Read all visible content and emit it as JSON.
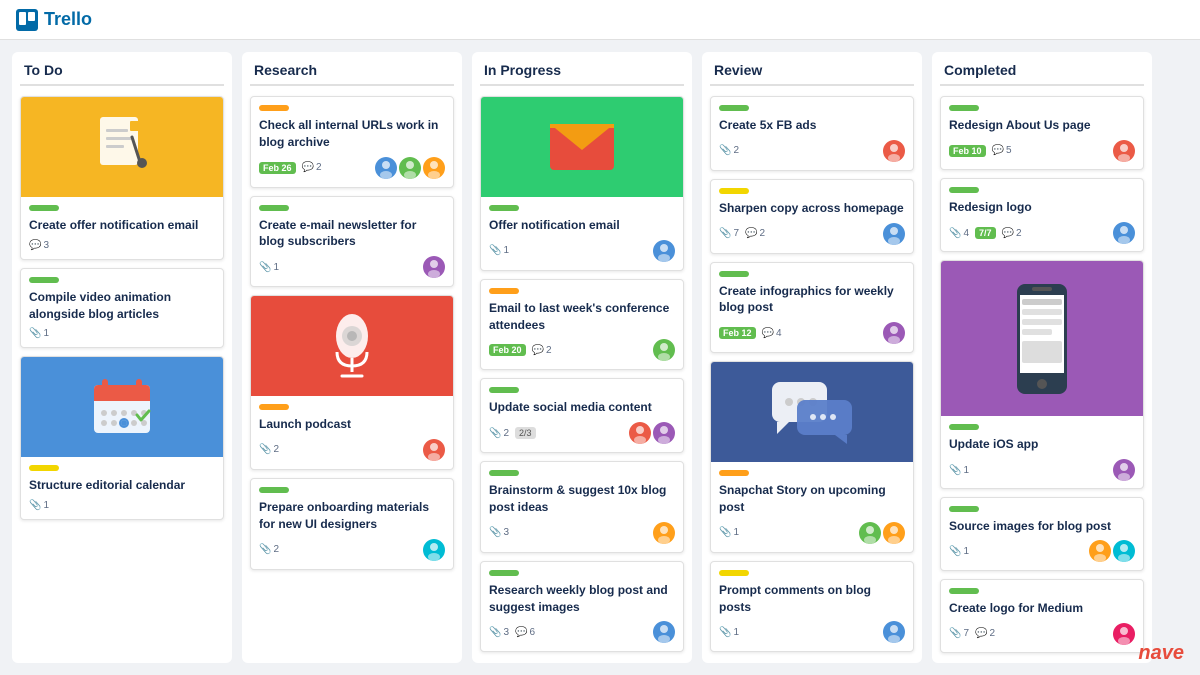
{
  "app": {
    "name": "Trello",
    "logo_text": "Trello"
  },
  "columns": [
    {
      "id": "todo",
      "title": "To Do",
      "cards": [
        {
          "id": "todo-1",
          "has_image": true,
          "image_type": "todo-doc",
          "label_color": "green",
          "title": "Create offer notification email",
          "meta": {
            "checklist": null,
            "attachments": null,
            "comments": "3",
            "date": null
          },
          "avatars": []
        },
        {
          "id": "todo-2",
          "has_image": false,
          "label_color": "green",
          "title": "Compile video animation alongside blog articles",
          "meta": {
            "checklist": null,
            "attachments": "1",
            "comments": null,
            "date": null
          },
          "avatars": []
        },
        {
          "id": "todo-3",
          "has_image": true,
          "image_type": "todo-cal",
          "label_color": "yellow",
          "title": "Structure editorial calendar",
          "meta": {
            "checklist": null,
            "attachments": "1",
            "comments": null,
            "date": null
          },
          "avatars": []
        }
      ]
    },
    {
      "id": "research",
      "title": "Research",
      "cards": [
        {
          "id": "res-1",
          "has_image": false,
          "label_color": "orange",
          "title": "Check all internal URLs work in blog archive",
          "meta": {
            "date": "Feb 26",
            "checklist": null,
            "attachments": null,
            "comments": "2"
          },
          "avatars": [
            "blue",
            "green",
            "orange"
          ]
        },
        {
          "id": "res-2",
          "has_image": false,
          "label_color": "green",
          "title": "Create e-mail newsletter for blog subscribers",
          "meta": {
            "date": null,
            "checklist": null,
            "attachments": "1",
            "comments": null
          },
          "avatars": [
            "purple"
          ]
        },
        {
          "id": "res-3",
          "has_image": true,
          "image_type": "research-mic",
          "label_color": "orange",
          "title": "Launch podcast",
          "meta": {
            "date": null,
            "checklist": null,
            "attachments": "2",
            "comments": null
          },
          "avatars": [
            "red"
          ]
        },
        {
          "id": "res-4",
          "has_image": false,
          "label_color": "green",
          "title": "Prepare onboarding materials for new UI designers",
          "meta": {
            "date": null,
            "checklist": null,
            "attachments": "2",
            "comments": null
          },
          "avatars": [
            "teal"
          ]
        }
      ]
    },
    {
      "id": "in-progress",
      "title": "In Progress",
      "cards": [
        {
          "id": "ip-1",
          "has_image": true,
          "image_type": "ip-email",
          "label_color": "green",
          "title": "Offer notification email",
          "meta": {
            "date": null,
            "checklist": null,
            "attachments": "1",
            "comments": null
          },
          "avatars": [
            "blue"
          ]
        },
        {
          "id": "ip-2",
          "has_image": false,
          "label_color": "orange",
          "title": "Email to last week's conference attendees",
          "meta": {
            "date": "Feb 20",
            "checklist": null,
            "attachments": null,
            "comments": "2"
          },
          "avatars": [
            "green"
          ]
        },
        {
          "id": "ip-3",
          "has_image": false,
          "label_color": "green",
          "title": "Update social media content",
          "meta": {
            "date": null,
            "checklist": null,
            "attachments": "2",
            "progress": "2/3",
            "comments": null
          },
          "avatars": [
            "red",
            "purple"
          ]
        },
        {
          "id": "ip-4",
          "has_image": false,
          "label_color": "green",
          "title": "Brainstorm & suggest 10x blog post ideas",
          "meta": {
            "date": null,
            "checklist": null,
            "attachments": "3",
            "comments": null
          },
          "avatars": [
            "orange"
          ]
        },
        {
          "id": "ip-5",
          "has_image": false,
          "label_color": "green",
          "title": "Research weekly blog post and suggest images",
          "meta": {
            "date": null,
            "checklist": null,
            "attachments": "3",
            "comments": "6"
          },
          "avatars": [
            "blue"
          ]
        }
      ]
    },
    {
      "id": "review",
      "title": "Review",
      "cards": [
        {
          "id": "rev-1",
          "has_image": false,
          "label_color": "green",
          "title": "Create 5x FB ads",
          "meta": {
            "date": null,
            "checklist": null,
            "attachments": "2",
            "comments": null
          },
          "avatars": [
            "red"
          ]
        },
        {
          "id": "rev-2",
          "has_image": false,
          "label_color": "yellow",
          "title": "Sharpen copy across homepage",
          "meta": {
            "date": null,
            "checklist": null,
            "attachments": "7",
            "comments": "2"
          },
          "avatars": [
            "blue"
          ]
        },
        {
          "id": "rev-3",
          "has_image": false,
          "label_color": "green",
          "title": "Create infographics for weekly blog post",
          "meta": {
            "date": "Feb 12",
            "checklist": null,
            "attachments": null,
            "comments": "4"
          },
          "avatars": [
            "purple"
          ]
        },
        {
          "id": "rev-4",
          "has_image": true,
          "image_type": "review-chat",
          "label_color": "orange",
          "title": "Snapchat Story on upcoming post",
          "meta": {
            "date": null,
            "checklist": null,
            "attachments": "1",
            "comments": null
          },
          "avatars": [
            "green",
            "orange"
          ]
        },
        {
          "id": "rev-5",
          "has_image": false,
          "label_color": "yellow",
          "title": "Prompt comments on blog posts",
          "meta": {
            "date": null,
            "checklist": null,
            "attachments": "1",
            "comments": null
          },
          "avatars": [
            "blue"
          ]
        }
      ]
    },
    {
      "id": "completed",
      "title": "Completed",
      "cards": [
        {
          "id": "comp-1",
          "has_image": false,
          "label_color": "green",
          "title": "Redesign About Us page",
          "meta": {
            "date": "Feb 10",
            "checklist": null,
            "attachments": null,
            "comments": "5"
          },
          "avatars": [
            "red"
          ]
        },
        {
          "id": "comp-2",
          "has_image": false,
          "label_color": "green",
          "title": "Redesign logo",
          "meta": {
            "date": null,
            "checklist": null,
            "attachments": "4",
            "comments": "2",
            "progress": "7/7"
          },
          "avatars": [
            "blue"
          ]
        },
        {
          "id": "comp-3",
          "has_image": true,
          "image_type": "completed-phone",
          "label_color": "green",
          "title": "Update iOS app",
          "meta": {
            "date": null,
            "checklist": null,
            "attachments": "1",
            "comments": null
          },
          "avatars": [
            "purple"
          ]
        },
        {
          "id": "comp-4",
          "has_image": false,
          "label_color": "green",
          "title": "Source images for blog post",
          "meta": {
            "date": null,
            "checklist": null,
            "attachments": "1",
            "comments": null
          },
          "avatars": [
            "orange",
            "teal"
          ]
        },
        {
          "id": "comp-5",
          "has_image": false,
          "label_color": "green",
          "title": "Create logo for Medium",
          "meta": {
            "date": null,
            "checklist": null,
            "attachments": "7",
            "comments": "2"
          },
          "avatars": [
            "pink"
          ]
        }
      ]
    }
  ],
  "nave_label": "nave"
}
